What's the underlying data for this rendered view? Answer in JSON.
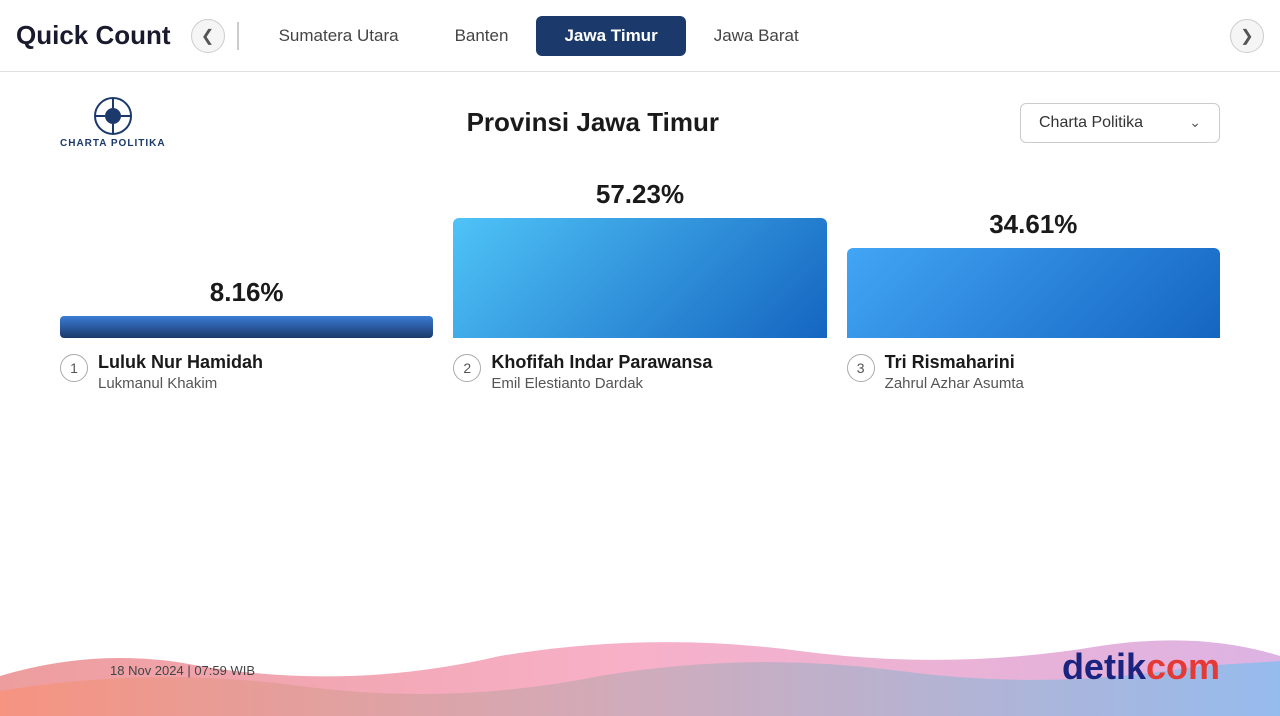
{
  "header": {
    "title": "Quick Count",
    "tabs": [
      {
        "label": "Sumatera Utara",
        "active": false
      },
      {
        "label": "Banten",
        "active": false
      },
      {
        "label": "Jawa Timur",
        "active": true
      },
      {
        "label": "Jawa Barat",
        "active": false
      }
    ]
  },
  "page": {
    "province_title": "Provinsi Jawa Timur",
    "source_label": "Charta Politika"
  },
  "candidates": [
    {
      "number": "1",
      "pct": "8.16%",
      "main_name": "Luluk Nur Hamidah",
      "sub_name": "Lukmanul Khakim",
      "bar_type": "bar-1"
    },
    {
      "number": "2",
      "pct": "57.23%",
      "main_name": "Khofifah Indar Parawansa",
      "sub_name": "Emil Elestianto Dardak",
      "bar_type": "bar-2"
    },
    {
      "number": "3",
      "pct": "34.61%",
      "main_name": "Tri Rismaharini",
      "sub_name": "Zahrul Azhar Asumta",
      "bar_type": "bar-3"
    }
  ],
  "footer": {
    "timestamp": "18 Nov 2024 | 07:59 WIB",
    "brand_detik": "detik",
    "brand_com": "com"
  },
  "icons": {
    "chevron_left": "❮",
    "chevron_right": "❯",
    "chevron_down": "⌄"
  }
}
